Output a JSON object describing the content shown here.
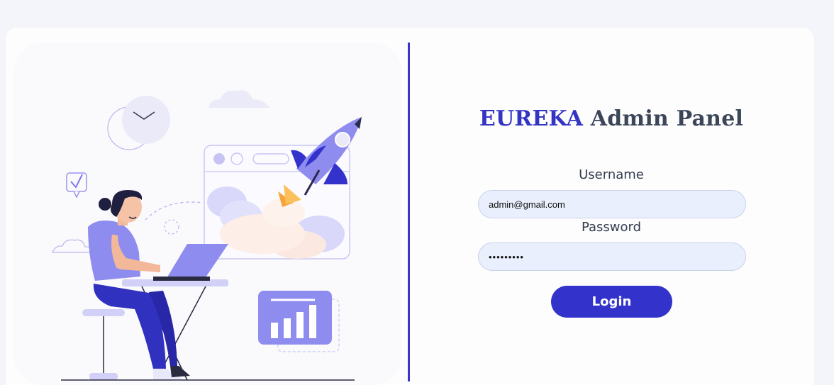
{
  "header": {
    "brand": "EUREKA",
    "rest": " Admin Panel"
  },
  "form": {
    "username_label": "Username",
    "username_value": "admin@gmail.com",
    "password_label": "Password",
    "password_value": "•••••••••",
    "login_label": "Login"
  },
  "illustration": {
    "subject": "person-working-on-laptop-with-rocket-launch",
    "icons": [
      "clock-icon",
      "checkmark-bubble-icon",
      "rocket-icon",
      "bar-chart-icon",
      "cloud-icon",
      "browser-window-icon"
    ]
  },
  "colors": {
    "accent": "#3333cc",
    "title_text": "#3b4659",
    "input_bg": "#e9effd",
    "page_bg": "#f4f5fa",
    "illustration_purple": "#8f8cf0"
  }
}
